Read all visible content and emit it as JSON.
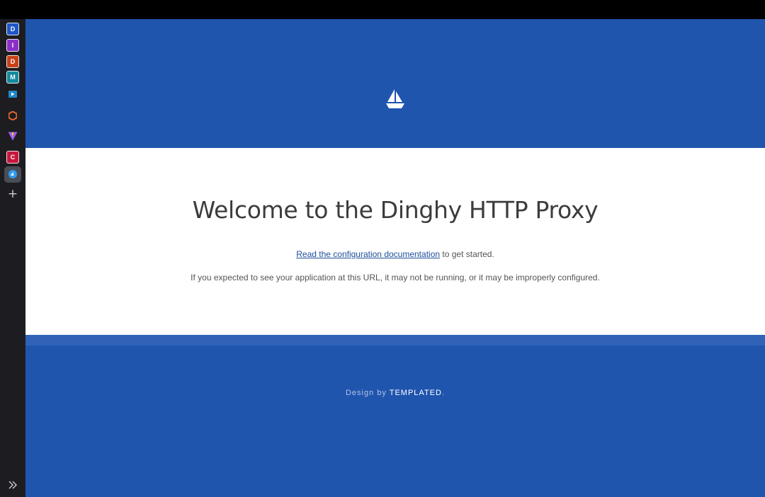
{
  "sidebar": {
    "apps": [
      {
        "letter": "D",
        "color": "#1f56c8"
      },
      {
        "letter": "I",
        "color": "#8b2fc9"
      },
      {
        "letter": "D",
        "color": "#c8401a"
      },
      {
        "letter": "M",
        "color": "#138a9c"
      },
      {
        "letter": "C",
        "color": "#c8173f"
      }
    ],
    "icons": [
      "video-app-icon",
      "office-app-icon",
      "vite-app-icon",
      "dinghy-app-icon"
    ],
    "add_label": "+"
  },
  "page": {
    "title": "Welcome to the Dinghy HTTP Proxy",
    "doc_link": "Read the configuration documentation",
    "doc_suffix": " to get started.",
    "note": "If you expected to see your application at this URL, it may not be running, or it may be improperly configured."
  },
  "footer": {
    "prefix": "Design by ",
    "brand": "TEMPLATED",
    "suffix": "."
  },
  "colors": {
    "brand_blue": "#2055ae",
    "strip_blue": "#3063b8",
    "link": "#1d4f9a"
  }
}
